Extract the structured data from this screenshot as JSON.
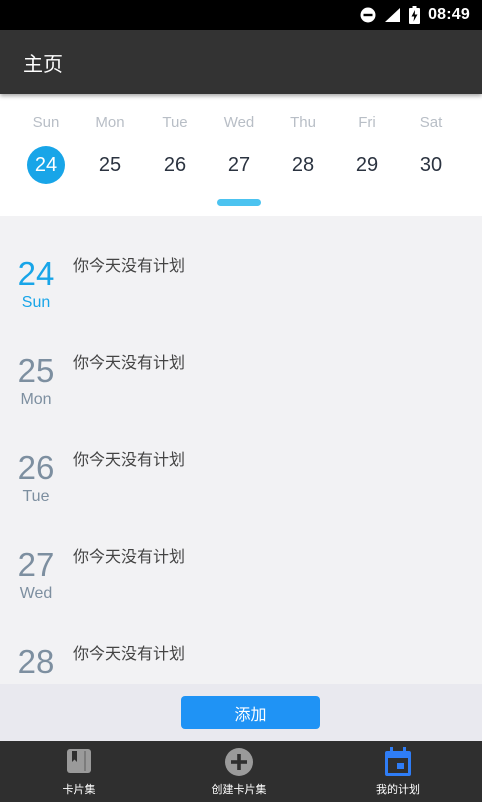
{
  "status_bar": {
    "time": "08:49",
    "icons": [
      "do-not-disturb-icon",
      "signal-icon",
      "battery-charging-icon"
    ]
  },
  "app_bar": {
    "title": "主页"
  },
  "week_strip": {
    "days": [
      {
        "dow": "Sun",
        "date": "24",
        "selected": true
      },
      {
        "dow": "Mon",
        "date": "25"
      },
      {
        "dow": "Tue",
        "date": "26"
      },
      {
        "dow": "Wed",
        "date": "27"
      },
      {
        "dow": "Thu",
        "date": "28"
      },
      {
        "dow": "Fri",
        "date": "29"
      },
      {
        "dow": "Sat",
        "date": "30"
      }
    ]
  },
  "plans": [
    {
      "date": "24",
      "weekday": "Sun",
      "message": "你今天没有计划",
      "today": true
    },
    {
      "date": "25",
      "weekday": "Mon",
      "message": "你今天没有计划"
    },
    {
      "date": "26",
      "weekday": "Tue",
      "message": "你今天没有计划"
    },
    {
      "date": "27",
      "weekday": "Wed",
      "message": "你今天没有计划"
    },
    {
      "date": "28",
      "weekday": "",
      "message": "你今天没有计划"
    }
  ],
  "add_button": {
    "label": "添加"
  },
  "bottom_nav": {
    "items": [
      {
        "label": "卡片集",
        "icon": "book-icon",
        "active": false
      },
      {
        "label": "创建卡片集",
        "icon": "add-circle-icon",
        "active": false
      },
      {
        "label": "我的计划",
        "icon": "calendar-icon",
        "active": true
      }
    ]
  },
  "colors": {
    "accent": "#18a5e8",
    "button": "#1f93f5",
    "nav_active": "#2f7df6",
    "appbar": "#333333"
  }
}
